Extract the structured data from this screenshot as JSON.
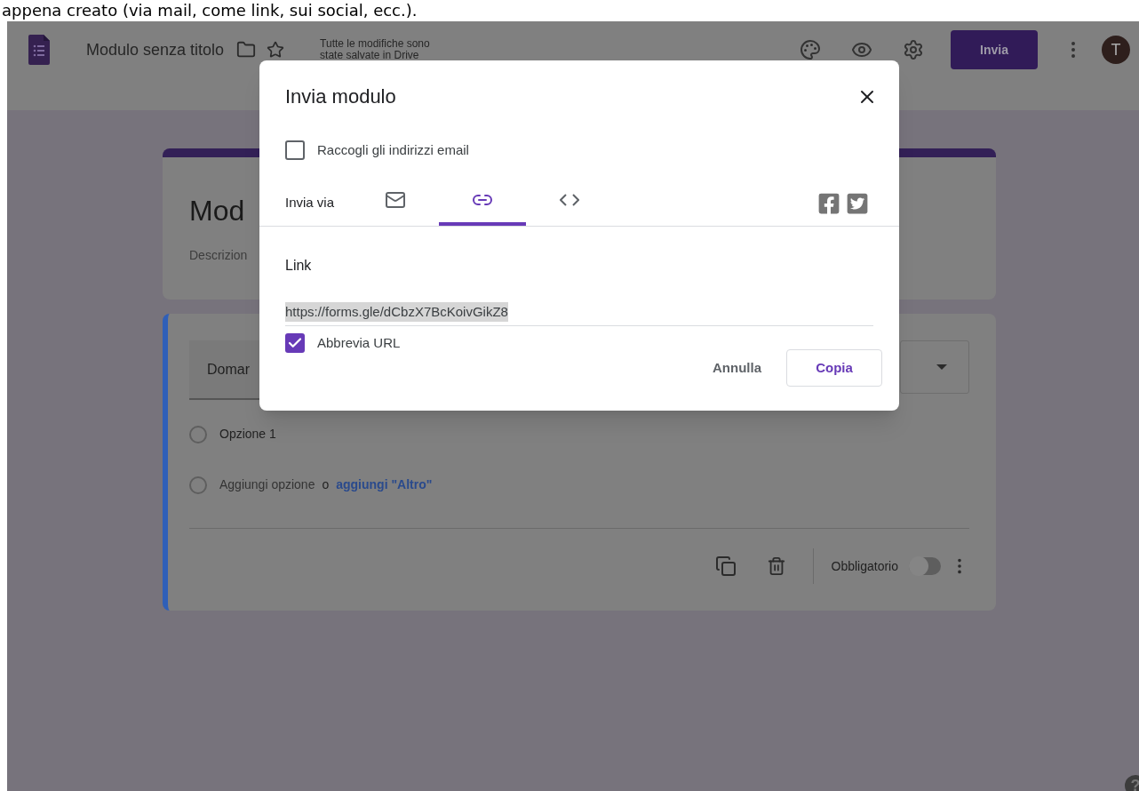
{
  "document_text": "appena creato (via mail, come link, sui social, ecc.).",
  "header": {
    "title": "Modulo senza titolo",
    "save_status": "Tutte le modifiche sono state salvate in Drive",
    "send_button": "Invia",
    "avatar": "T"
  },
  "form": {
    "title": "Mod",
    "description": "Descrizion",
    "question": {
      "title": "Domar",
      "options": [
        {
          "label": "Opzione 1",
          "selected": false
        }
      ],
      "add_option": "Aggiungi opzione",
      "or": "o",
      "add_other": "aggiungi \"Altro\"",
      "required_label": "Obbligatorio",
      "required": false
    }
  },
  "dialog": {
    "title": "Invia modulo",
    "collect_emails": {
      "label": "Raccogli gli indirizzi email",
      "checked": false
    },
    "send_via_label": "Invia via",
    "tabs": [
      {
        "kind": "email",
        "selected": false
      },
      {
        "kind": "link",
        "selected": true
      },
      {
        "kind": "embed",
        "selected": false
      }
    ],
    "link_label": "Link",
    "link_url": "https://forms.gle/dCbzX7BcKoivGikZ8",
    "shorten_url": {
      "label": "Abbrevia URL",
      "checked": true
    },
    "buttons": {
      "cancel": "Annulla",
      "copy": "Copia"
    }
  },
  "help_button": "?"
}
